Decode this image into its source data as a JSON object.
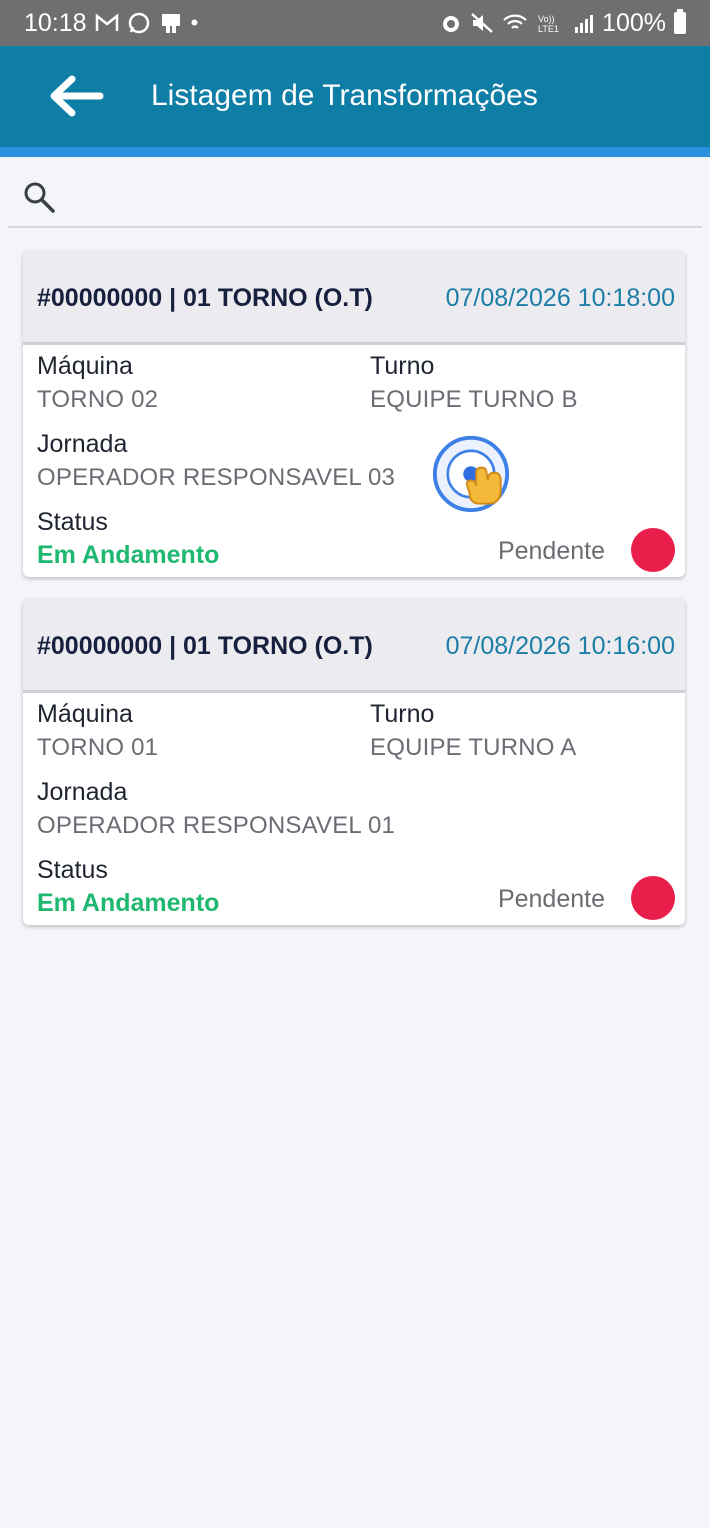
{
  "status_bar": {
    "time": "10:18",
    "left_icons": [
      "gmail-icon",
      "whatsapp-icon",
      "app-icon",
      "dot-icon"
    ],
    "right_icons": [
      "alarm-icon",
      "mute-icon",
      "wifi-icon",
      "volte-icon",
      "signal-icon"
    ],
    "battery": "100%"
  },
  "appbar": {
    "title": "Listagem de Transformações",
    "back_icon": "back-arrow-icon"
  },
  "search": {
    "icon": "search-icon",
    "placeholder": "",
    "value": ""
  },
  "labels": {
    "machine": "Máquina",
    "shift": "Turno",
    "journey": "Jornada",
    "status": "Status"
  },
  "cards": [
    {
      "code": "#00000000 | 01 TORNO (O.T)",
      "datetime": "07/08/2026 10:18:00",
      "machine": "TORNO 02",
      "shift": "EQUIPE TURNO B",
      "journey": "OPERADOR RESPONSAVEL 03",
      "status": "Em Andamento",
      "pending_label": "Pendente"
    },
    {
      "code": "#00000000 | 01 TORNO (O.T)",
      "datetime": "07/08/2026 10:16:00",
      "machine": "TORNO 01",
      "shift": "EQUIPE TURNO A",
      "journey": "OPERADOR RESPONSAVEL 01",
      "status": "Em Andamento",
      "pending_label": "Pendente"
    }
  ],
  "colors": {
    "appbar": "#0f7ea6",
    "accent_bar": "#2b90de",
    "status_green": "#1fb870",
    "pending_red": "#ea1e4a",
    "date_blue": "#1c7ea6"
  }
}
